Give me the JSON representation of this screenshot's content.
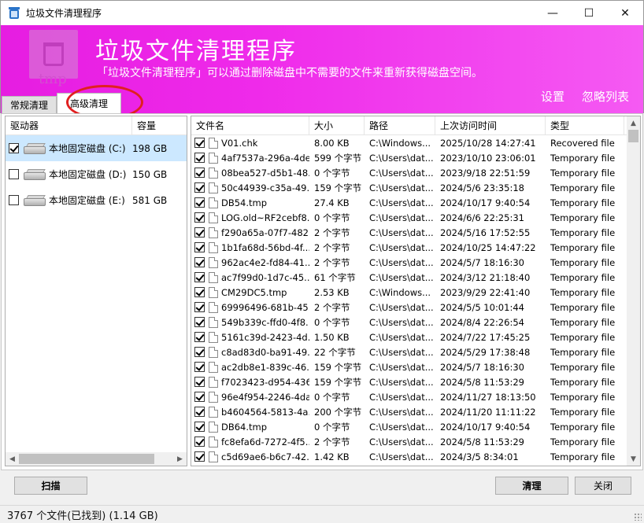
{
  "window": {
    "title": "垃圾文件清理程序",
    "controls": {
      "minimize": "—",
      "maximize": "☐",
      "close": "✕"
    }
  },
  "banner": {
    "logo_text": "tmp",
    "title": "垃圾文件清理程序",
    "subtitle": "「垃圾文件清理程序」可以通过删除磁盘中不需要的文件来重新获得磁盘空间。",
    "links": [
      "设置",
      "忽略列表"
    ]
  },
  "tabs": [
    {
      "label": "常规清理",
      "active": false
    },
    {
      "label": "高级清理",
      "active": true
    }
  ],
  "drives": {
    "headers": [
      "驱动器",
      "容量"
    ],
    "rows": [
      {
        "name": "本地固定磁盘 (C:)",
        "capacity": "198 GB",
        "checked": true,
        "selected": true
      },
      {
        "name": "本地固定磁盘 (D:)",
        "capacity": "150 GB",
        "checked": false,
        "selected": false
      },
      {
        "name": "本地固定磁盘 (E:)",
        "capacity": "581 GB",
        "checked": false,
        "selected": false
      }
    ]
  },
  "files": {
    "headers": [
      "文件名",
      "大小",
      "路径",
      "上次访问时间",
      "类型"
    ],
    "rows": [
      {
        "name": "V01.chk",
        "size": "8.00 KB",
        "path": "C:\\Windows...",
        "accessed": "2025/10/28 14:27:41",
        "type": "Recovered file",
        "icon": "chk-file-icon"
      },
      {
        "name": "4af7537a-296a-4de...",
        "size": "599 个字节",
        "path": "C:\\Users\\dat...",
        "accessed": "2023/10/10 23:06:01",
        "type": "Temporary file",
        "icon": "file-icon"
      },
      {
        "name": "08bea527-d5b1-48...",
        "size": "0 个字节",
        "path": "C:\\Users\\dat...",
        "accessed": "2023/9/18 22:51:59",
        "type": "Temporary file",
        "icon": "file-icon"
      },
      {
        "name": "50c44939-c35a-49...",
        "size": "159 个字节",
        "path": "C:\\Users\\dat...",
        "accessed": "2024/5/6 23:35:18",
        "type": "Temporary file",
        "icon": "file-icon"
      },
      {
        "name": "DB54.tmp",
        "size": "27.4 KB",
        "path": "C:\\Users\\dat...",
        "accessed": "2024/10/17 9:40:54",
        "type": "Temporary file",
        "icon": "file-icon"
      },
      {
        "name": "LOG.old~RF2cebf8...",
        "size": "0 个字节",
        "path": "C:\\Users\\dat...",
        "accessed": "2024/6/6 22:25:31",
        "type": "Temporary file",
        "icon": "file-icon"
      },
      {
        "name": "f290a65a-07f7-482...",
        "size": "2 个字节",
        "path": "C:\\Users\\dat...",
        "accessed": "2024/5/16 17:52:55",
        "type": "Temporary file",
        "icon": "file-icon"
      },
      {
        "name": "1b1fa68d-56bd-4f...",
        "size": "2 个字节",
        "path": "C:\\Users\\dat...",
        "accessed": "2024/10/25 14:47:22",
        "type": "Temporary file",
        "icon": "file-icon"
      },
      {
        "name": "962ac4e2-fd84-41...",
        "size": "2 个字节",
        "path": "C:\\Users\\dat...",
        "accessed": "2024/5/7 18:16:30",
        "type": "Temporary file",
        "icon": "file-icon"
      },
      {
        "name": "ac7f99d0-1d7c-45...",
        "size": "61 个字节",
        "path": "C:\\Users\\dat...",
        "accessed": "2024/3/12 21:18:40",
        "type": "Temporary file",
        "icon": "file-icon"
      },
      {
        "name": "CM29DC5.tmp",
        "size": "2.53 KB",
        "path": "C:\\Windows...",
        "accessed": "2023/9/29 22:41:40",
        "type": "Temporary file",
        "icon": "file-icon"
      },
      {
        "name": "69996496-681b-45...",
        "size": "2 个字节",
        "path": "C:\\Users\\dat...",
        "accessed": "2024/5/5 10:01:44",
        "type": "Temporary file",
        "icon": "file-icon"
      },
      {
        "name": "549b339c-ffd0-4f8...",
        "size": "0 个字节",
        "path": "C:\\Users\\dat...",
        "accessed": "2024/8/4 22:26:54",
        "type": "Temporary file",
        "icon": "file-icon"
      },
      {
        "name": "5161c39d-2423-4d...",
        "size": "1.50 KB",
        "path": "C:\\Users\\dat...",
        "accessed": "2024/7/22 17:45:25",
        "type": "Temporary file",
        "icon": "file-icon"
      },
      {
        "name": "c8ad83d0-ba91-49...",
        "size": "22 个字节",
        "path": "C:\\Users\\dat...",
        "accessed": "2024/5/29 17:38:48",
        "type": "Temporary file",
        "icon": "file-icon"
      },
      {
        "name": "ac2db8e1-839c-46...",
        "size": "159 个字节",
        "path": "C:\\Users\\dat...",
        "accessed": "2024/5/7 18:16:30",
        "type": "Temporary file",
        "icon": "file-icon"
      },
      {
        "name": "f7023423-d954-436...",
        "size": "159 个字节",
        "path": "C:\\Users\\dat...",
        "accessed": "2024/5/8 11:53:29",
        "type": "Temporary file",
        "icon": "file-icon"
      },
      {
        "name": "96e4f954-2246-4da...",
        "size": "0 个字节",
        "path": "C:\\Users\\dat...",
        "accessed": "2024/11/27 18:13:50",
        "type": "Temporary file",
        "icon": "file-icon"
      },
      {
        "name": "b4604564-5813-4a...",
        "size": "200 个字节",
        "path": "C:\\Users\\dat...",
        "accessed": "2024/11/20 11:11:22",
        "type": "Temporary file",
        "icon": "file-icon"
      },
      {
        "name": "DB64.tmp",
        "size": "0 个字节",
        "path": "C:\\Users\\dat...",
        "accessed": "2024/10/17 9:40:54",
        "type": "Temporary file",
        "icon": "file-icon"
      },
      {
        "name": "fc8efa6d-7272-4f5...",
        "size": "2 个字节",
        "path": "C:\\Users\\dat...",
        "accessed": "2024/5/8 11:53:29",
        "type": "Temporary file",
        "icon": "file-icon"
      },
      {
        "name": "c5d69ae6-b6c7-42...",
        "size": "1.42 KB",
        "path": "C:\\Users\\dat...",
        "accessed": "2024/3/5 8:34:01",
        "type": "Temporary file",
        "icon": "file-icon"
      }
    ]
  },
  "buttons": {
    "scan": "扫描",
    "clean": "清理",
    "close": "关闭"
  },
  "status": {
    "text": "3767  个文件(已找到) (1.14 GB)"
  },
  "colors": {
    "banner": "#ef2aea",
    "selection": "#cce8ff",
    "annotation_ring": "#e02020"
  }
}
